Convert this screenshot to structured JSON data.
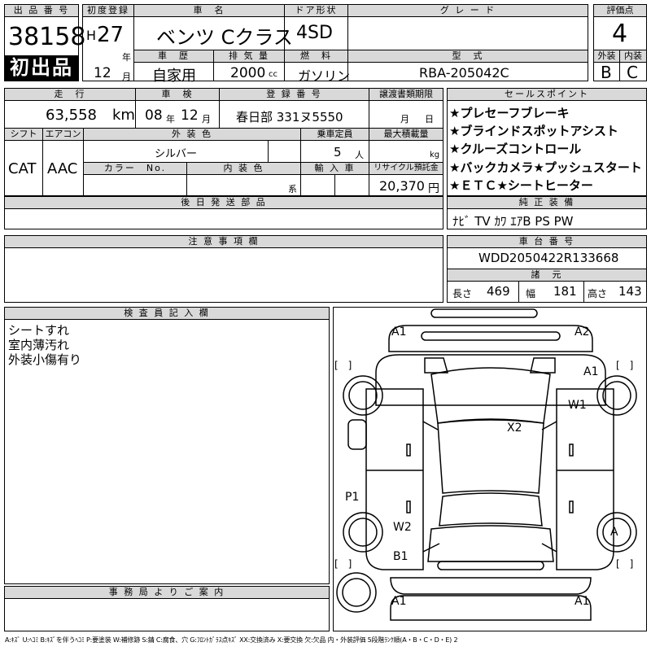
{
  "lot": {
    "label": "出 品 番 号",
    "number": "38158",
    "first_listing": "初出品"
  },
  "first_reg": {
    "label": "初度登録",
    "era": "H",
    "year": "27",
    "year_unit": "年",
    "month": "12",
    "month_unit": "月"
  },
  "car_name": {
    "label": "車　名",
    "value": "ベンツ Cクラス"
  },
  "door": {
    "label": "ドア形状",
    "value": "4SD"
  },
  "grade": {
    "label": "グ レ ー ド",
    "value": ""
  },
  "score": {
    "label": "評価点",
    "value": "4",
    "ext_label": "外装",
    "int_label": "内装",
    "ext_value": "B",
    "int_value": "C"
  },
  "history": {
    "label": "車　歴",
    "value": "自家用"
  },
  "displacement": {
    "label": "排 気 量",
    "value": "2000",
    "unit": "cc"
  },
  "fuel": {
    "label": "燃　料",
    "value": "ガソリン"
  },
  "model": {
    "label": "型　式",
    "value": "RBA-205042C"
  },
  "mileage": {
    "label": "走　行",
    "value": "63,558",
    "unit": "km"
  },
  "inspection": {
    "label": "車　検",
    "year": "08",
    "year_unit": "年",
    "month": "12",
    "month_unit": "月"
  },
  "reg_no": {
    "label": "登 録 番 号",
    "value": "春日部 331ヌ5550"
  },
  "transfer": {
    "label": "譲渡書類期限",
    "month_unit": "月",
    "day_unit": "日"
  },
  "sales_points": {
    "label": "セールスポイント",
    "items": [
      "★プレセーフブレーキ",
      "★ブラインドスポットアシスト",
      "★クルーズコントロール",
      "★バックカメラ★プッシュスタート",
      "★ＥＴＣ★シートヒーター"
    ]
  },
  "shift": {
    "label": "シフト",
    "value": "CAT"
  },
  "ac": {
    "label": "エアコン",
    "value": "AAC"
  },
  "ext_color": {
    "label": "外 装 色",
    "value": "シルバー"
  },
  "capacity": {
    "label": "乗車定員",
    "value": "5",
    "unit": "人"
  },
  "load": {
    "label": "最大積載量",
    "unit": "kg"
  },
  "color_no": {
    "label": "カラー　No."
  },
  "int_color": {
    "label": "内 装 色",
    "unit": "系"
  },
  "import": {
    "label": "輸 入 車"
  },
  "recycle": {
    "label": "リサイクル預託金",
    "value": "20,370",
    "unit": "円"
  },
  "later_parts": {
    "label": "後 日 発 送 部 品"
  },
  "equipment": {
    "label": "純 正 装 備",
    "value": "ﾅﾋﾞ TV ｶﾜ ｴｱB PS PW"
  },
  "notes": {
    "label": "注 意 事 項 欄"
  },
  "chassis": {
    "label": "車 台 番 号",
    "value": "WDD2050422R133668"
  },
  "specs": {
    "label": "諸　元",
    "length_label": "長さ",
    "length": "469",
    "width_label": "幅",
    "width": "181",
    "height_label": "高さ",
    "height": "143"
  },
  "inspector": {
    "label": "検 査 員 記 入 欄",
    "lines": [
      "シートすれ",
      "室内薄汚れ",
      "外装小傷有り"
    ]
  },
  "office": {
    "label": "事 務 局 よ り ご 案 内"
  },
  "diagram": {
    "marks": {
      "a1_front_left": "A1",
      "a2_front_right": "A2",
      "a1_fender_right": "A1",
      "w1": "W1",
      "x2": "X2",
      "p1": "P1",
      "w2": "W2",
      "b1": "B1",
      "a_rear_right": "A",
      "a1_rear_left": "A1",
      "a1_rear_right": "A1"
    },
    "tire_marks": [
      "[　]",
      "[　]",
      "[　]",
      "[　]"
    ]
  },
  "legend": "A:ｷｽﾞ U:ﾍｺﾐ B:ｷｽﾞを伴うﾍｺﾐ P:要塗装 W:補修跡 S:錆 C:腐食、穴 G:ﾌﾛﾝﾄｶﾞﾗｽ点ｷｽﾞ XX:交換済み X:要交換 欠:欠品 内・外装評価 5段階ﾗﾝｸ順(A・B・C・D・E) 2"
}
